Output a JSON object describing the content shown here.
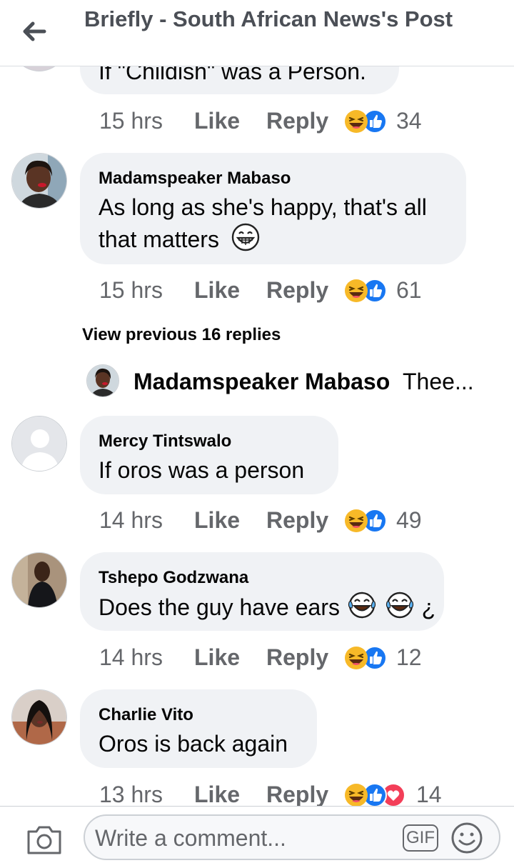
{
  "header": {
    "title": "Briefly - South African News's Post"
  },
  "comments": [
    {
      "name": "",
      "text": "If \"Childish\" was a Person.",
      "time": "15 hrs",
      "like": "Like",
      "reply": "Reply",
      "reactions": [
        "haha",
        "like"
      ],
      "count": "34"
    },
    {
      "name": "Madamspeaker Mabaso",
      "text": "As long as she's happy, that's all",
      "text2": "that matters",
      "time": "15 hrs",
      "like": "Like",
      "reply": "Reply",
      "reactions": [
        "haha",
        "like"
      ],
      "count": "61"
    },
    {
      "name": "Mercy Tintswalo",
      "text": "If oros was a person",
      "time": "14 hrs",
      "like": "Like",
      "reply": "Reply",
      "reactions": [
        "haha",
        "like"
      ],
      "count": "49"
    },
    {
      "name": "Tshepo Godzwana",
      "text": "Does the guy have ears",
      "text_suffix": "¿",
      "time": "14 hrs",
      "like": "Like",
      "reply": "Reply",
      "reactions": [
        "haha",
        "like"
      ],
      "count": "12"
    },
    {
      "name": "Charlie Vito",
      "text": "Oros is back again",
      "time": "13 hrs",
      "like": "Like",
      "reply": "Reply",
      "reactions": [
        "haha",
        "like",
        "love"
      ],
      "count": "14"
    }
  ],
  "replies_preview": {
    "view_previous": "View previous 16 replies",
    "name": "Madamspeaker Mabaso",
    "text": "Thee..."
  },
  "footer": {
    "placeholder": "Write a comment...",
    "gif_label": "GIF"
  },
  "colors": {
    "like_blue": "#1877f2",
    "haha_yellow": "#f7b928",
    "love_red": "#f33e58",
    "bubble": "#f0f2f5",
    "meta_gray": "#65676b"
  },
  "icons": [
    "back-arrow-icon",
    "haha-reaction-icon",
    "like-reaction-icon",
    "love-reaction-icon",
    "grin-emoji-icon",
    "tears-of-joy-emoji-icon",
    "camera-icon",
    "smiley-icon"
  ]
}
